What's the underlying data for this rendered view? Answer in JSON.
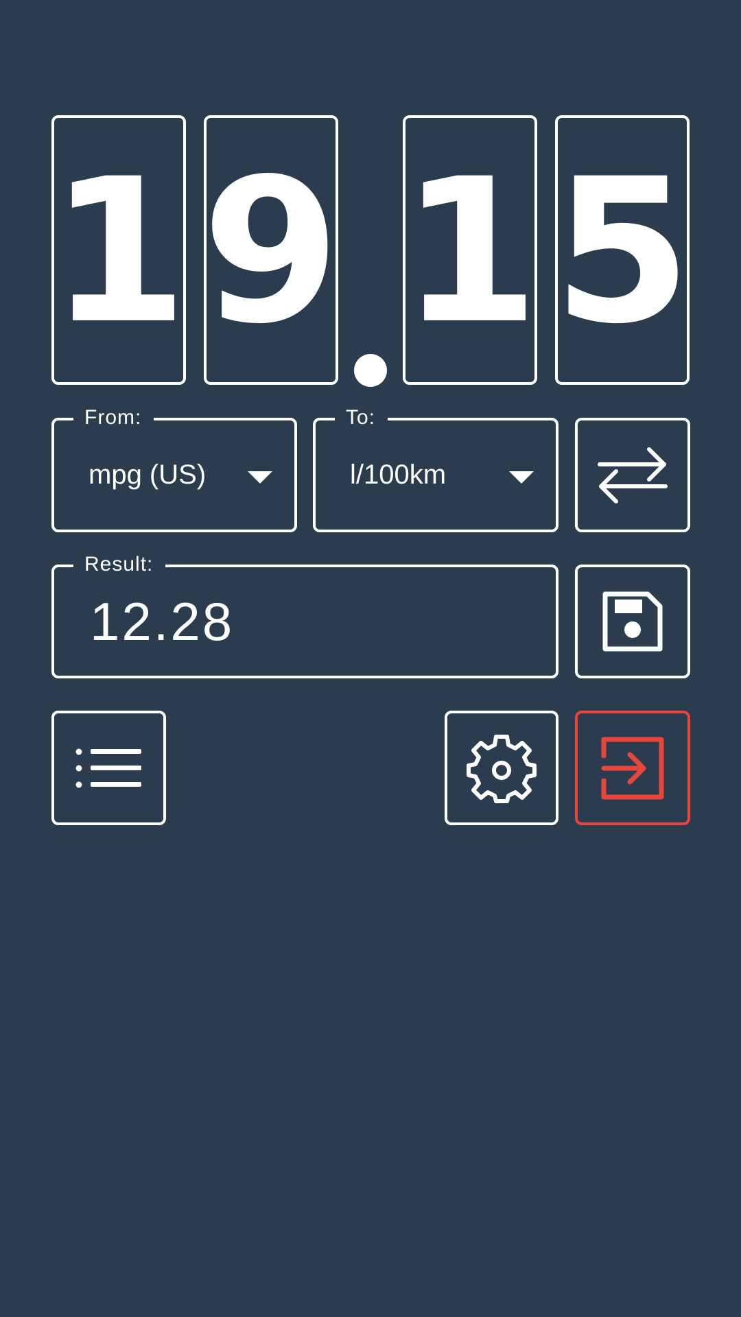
{
  "display": {
    "digits": [
      "1",
      "9",
      "1",
      "5"
    ]
  },
  "from": {
    "label": "From:",
    "value": "mpg (US)"
  },
  "to": {
    "label": "To:",
    "value": "l/100km"
  },
  "result": {
    "label": "Result:",
    "value": "12.28"
  },
  "icons": {
    "swap": "swap-arrows-icon",
    "save": "floppy-disk-icon",
    "list": "list-icon",
    "settings": "gear-icon",
    "exit": "sign-in-icon"
  },
  "colors": {
    "background": "#2b3c4f",
    "foreground": "#ffffff",
    "accent": "#e8453c"
  }
}
